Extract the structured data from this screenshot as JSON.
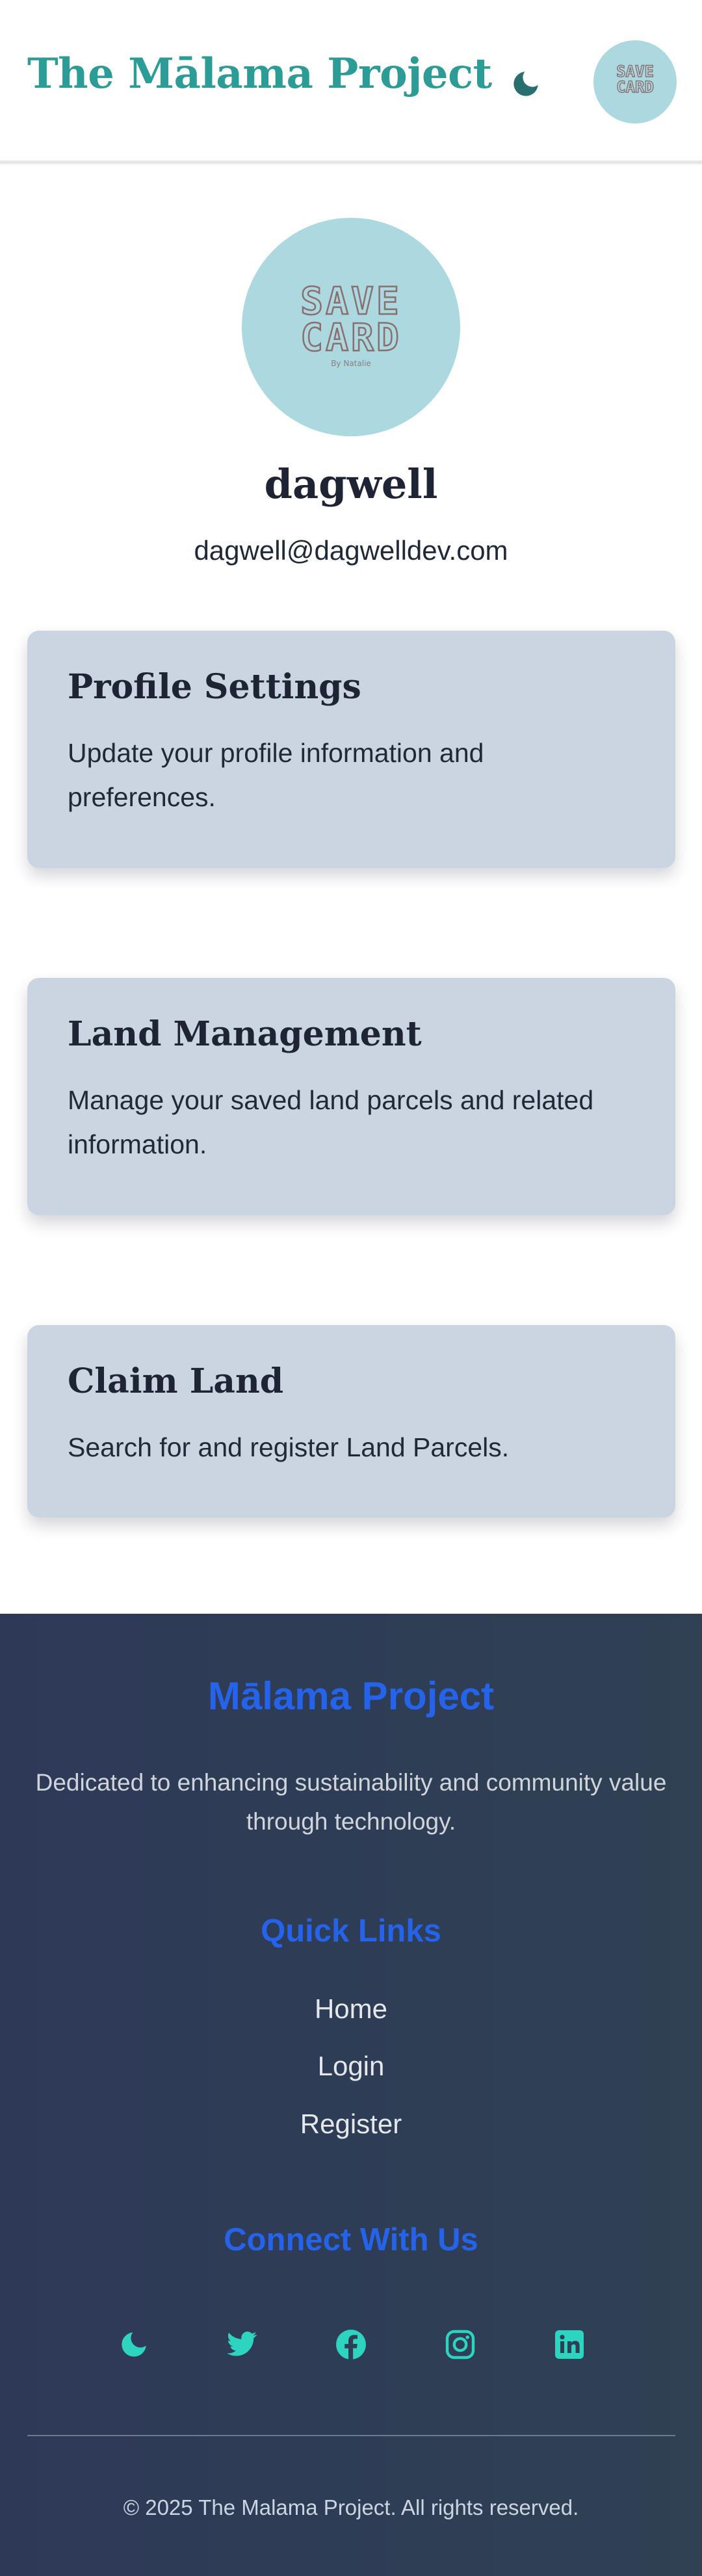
{
  "header": {
    "brand": "The Mālama Project",
    "theme_icon": "moon-icon",
    "avatar_text_top": "SAVE",
    "avatar_text_bottom": "CARD"
  },
  "profile": {
    "avatar_text_top": "SAVE",
    "avatar_text_bottom": "CARD",
    "avatar_byline": "By Natalie",
    "username": "dagwell",
    "email": "dagwell@dagwelldev.com"
  },
  "cards": [
    {
      "title": "Profile Settings",
      "description": "Update your profile information and preferences."
    },
    {
      "title": "Land Management",
      "description": "Manage your saved land parcels and related information."
    },
    {
      "title": "Claim Land",
      "description": "Search for and register Land Parcels."
    }
  ],
  "footer": {
    "title": "Mālama Project",
    "description": "Dedicated to enhancing sustainability and community value through technology.",
    "quick_links_title": "Quick Links",
    "links": [
      "Home",
      "Login",
      "Register"
    ],
    "connect_title": "Connect With Us",
    "social_icons": [
      "moon-icon",
      "twitter-icon",
      "facebook-icon",
      "instagram-icon",
      "linkedin-icon"
    ],
    "copyright": "© 2025 The Malama Project. All rights reserved."
  },
  "colors": {
    "brand_teal": "#2c9d96",
    "footer_heading_blue": "#2563eb",
    "card_background": "#cbd5e1",
    "avatar_background": "#acd8e0",
    "footer_icon_teal": "#2dd4bf"
  }
}
